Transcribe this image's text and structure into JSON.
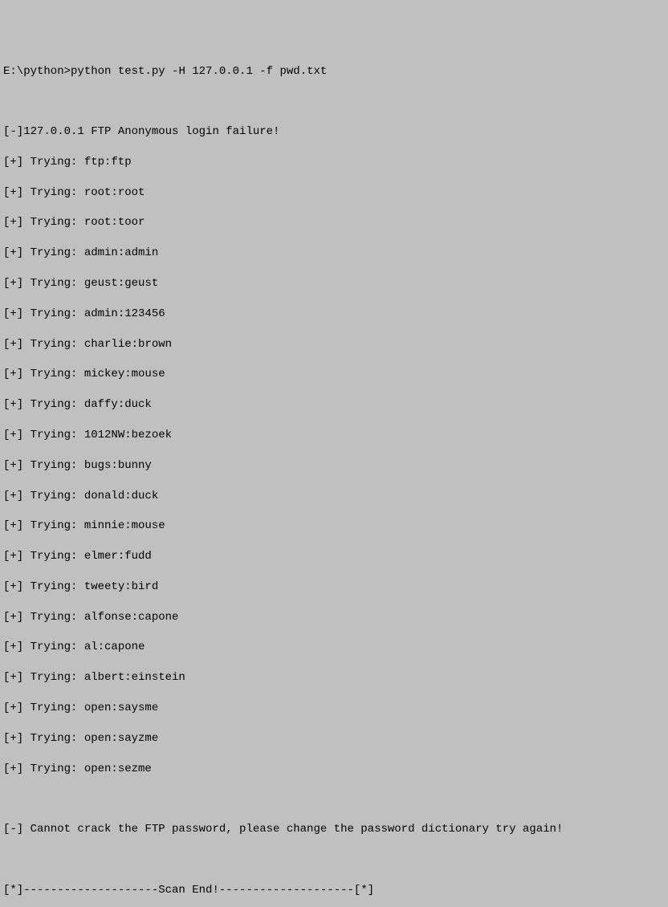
{
  "prompt": {
    "path": "E:\\python>",
    "command": "python test.py -H 127.0.0.1 -f pwd.txt"
  },
  "lines": [
    "[-]127.0.0.1 FTP Anonymous login failure!",
    "[+] Trying: ftp:ftp",
    "[+] Trying: root:root",
    "[+] Trying: root:toor",
    "[+] Trying: admin:admin",
    "[+] Trying: geust:geust",
    "[+] Trying: admin:123456",
    "[+] Trying: charlie:brown",
    "[+] Trying: mickey:mouse",
    "[+] Trying: daffy:duck",
    "[+] Trying: 1012NW:bezoek",
    "[+] Trying: bugs:bunny",
    "[+] Trying: donald:duck",
    "[+] Trying: minnie:mouse",
    "[+] Trying: elmer:fudd",
    "[+] Trying: tweety:bird",
    "[+] Trying: alfonse:capone",
    "[+] Trying: al:capone",
    "[+] Trying: albert:einstein",
    "[+] Trying: open:saysme",
    "[+] Trying: open:sayzme",
    "[+] Trying: open:sezme"
  ],
  "failure_message": "[-] Cannot crack the FTP password, please change the password dictionary try again!",
  "scan_end": "[*]--------------------Scan End!--------------------[*]"
}
